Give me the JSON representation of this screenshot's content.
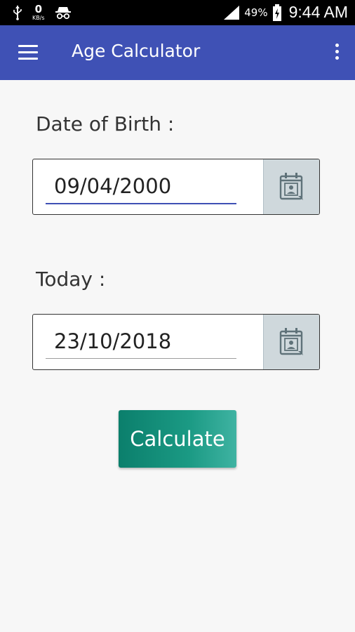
{
  "status_bar": {
    "data_speed_value": "0",
    "data_speed_unit": "KB/s",
    "battery": "49%",
    "time": "9:44 AM",
    "icons": [
      "usb-icon",
      "incognito-icon",
      "signal-icon",
      "battery-charging-icon"
    ]
  },
  "app_bar": {
    "title": "Age Calculator",
    "background": "#3f51b5",
    "icons": [
      "menu-icon",
      "overflow-menu-icon"
    ]
  },
  "form": {
    "dob_label": "Date of Birth :",
    "dob_value": "09/04/2000",
    "today_label": "Today :",
    "today_value": "23/10/2018",
    "calendar_icon": "calendar-icon",
    "calculate_label": "Calculate",
    "accent_color": "#0b7f6c"
  }
}
